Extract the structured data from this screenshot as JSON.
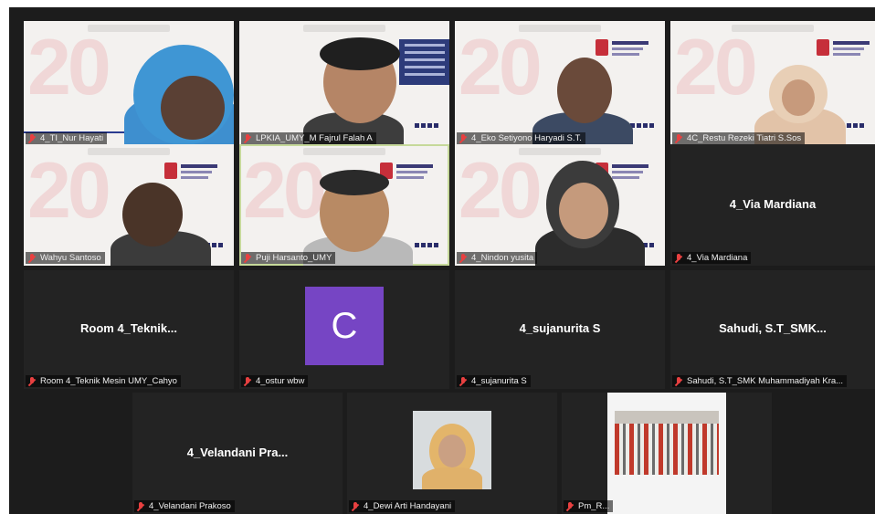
{
  "participants": [
    {
      "name": "4_TI_Nur Hayati",
      "type": "video",
      "active": false
    },
    {
      "name": "LPKIA_UMY_M Fajrul Falah A",
      "type": "video",
      "active": false
    },
    {
      "name": "4_Eko Setiyono Haryadi S.T.",
      "type": "video",
      "active": false
    },
    {
      "name": "4C_Restu Rezeki Tiatri S.Sos",
      "type": "video",
      "active": false
    },
    {
      "name": "Wahyu Santoso",
      "type": "video",
      "active": false
    },
    {
      "name": "Puji Harsanto_UMY",
      "type": "video",
      "active": true
    },
    {
      "name": "4_Nindon yusita",
      "type": "video",
      "active": false
    },
    {
      "name": "4_Via Mardiana",
      "display": "4_Via Mardiana",
      "type": "name-only",
      "active": false
    },
    {
      "name": "Room 4_Teknik Mesin UMY_Cahyo",
      "display": "Room  4_Teknik...",
      "type": "name-only",
      "active": false
    },
    {
      "name": "4_ostur wbw",
      "initial": "C",
      "type": "avatar",
      "active": false
    },
    {
      "name": "4_sujanurita S",
      "display": "4_sujanurita S",
      "type": "name-only",
      "active": false
    },
    {
      "name": "Sahudi, S.T_SMK Muhammadiyah Kra...",
      "display": "Sahudi,  S.T_SMK...",
      "type": "name-only",
      "active": false
    },
    {
      "name": "4_Velandani Prakoso",
      "display": "4_Velandani  Pra...",
      "type": "name-only",
      "active": false
    },
    {
      "name": "4_Dewi Arti Handayani",
      "type": "photo",
      "active": false
    },
    {
      "name": "Pm_R...",
      "type": "photo",
      "active": false
    }
  ],
  "colors": {
    "background": "#1c1c1c",
    "tile": "#232323",
    "active_border": "#c6d99a",
    "avatar": "#7645c4",
    "muted_mic": "#e84040"
  },
  "icons": [
    "muted-mic-icon"
  ]
}
